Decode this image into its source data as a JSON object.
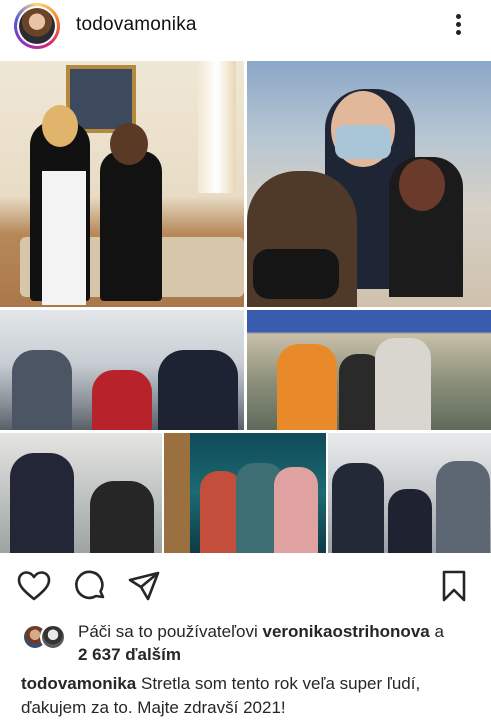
{
  "post": {
    "username": "todovamonika",
    "more_icon": "more-vertical-icon"
  },
  "collage": {
    "photos": [
      "photo-palace-meeting",
      "photo-selfie-three-people",
      "photo-office-group",
      "photo-shop-group",
      "photo-two-people-outside",
      "photo-stage-group",
      "photo-newsroom-group"
    ]
  },
  "actions": {
    "like_icon": "heart-icon",
    "comment_icon": "comment-icon",
    "share_icon": "send-icon",
    "save_icon": "bookmark-icon"
  },
  "likes": {
    "prefix": "Páči sa to používateľovi",
    "user": "veronikaostrihonova",
    "connector": "a",
    "others": "2 637 ďalším"
  },
  "caption": {
    "username": "todovamonika",
    "text": "Stretla som tento rok veľa super ľudí, ďakujem za to. Majte zdravší 2021!"
  }
}
